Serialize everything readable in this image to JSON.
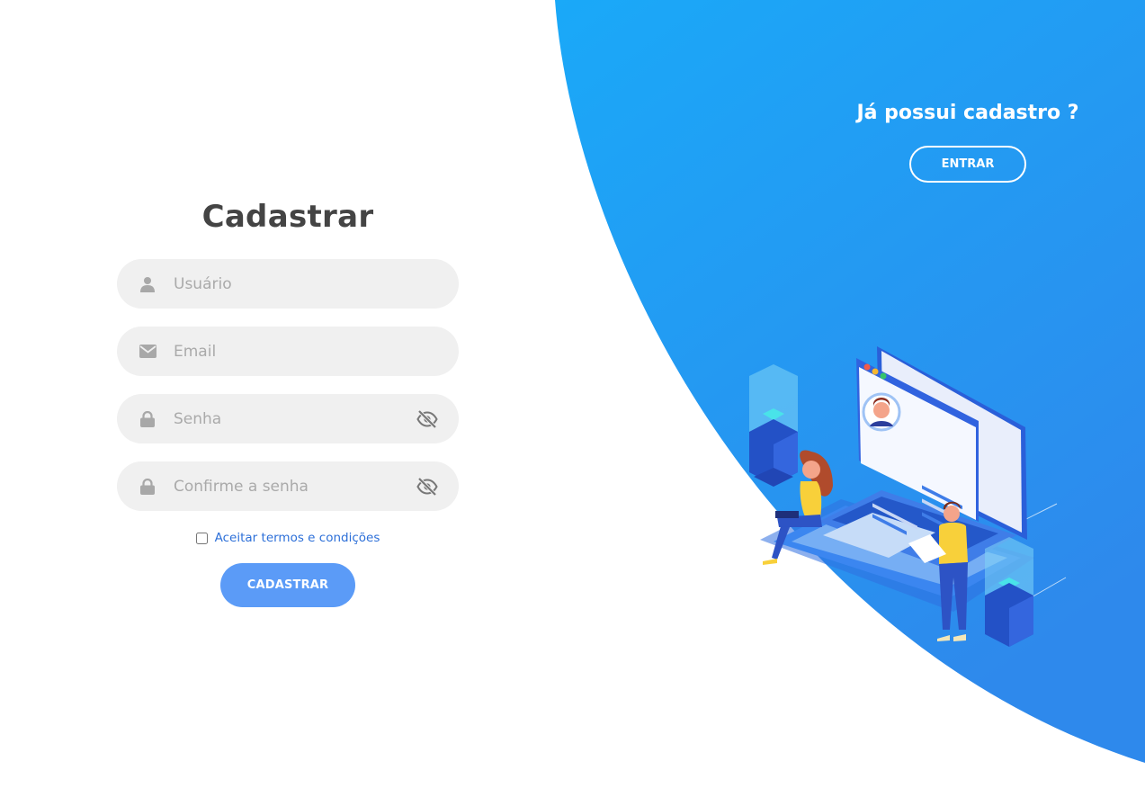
{
  "colors": {
    "accent_blue": "#5b9bf7",
    "panel_blue_top": "#1aa9f8",
    "panel_blue_bottom": "#2e89ec",
    "field_bg": "#f0f0f0",
    "title_text": "#444444",
    "link_text": "#2c6fd8"
  },
  "register": {
    "title": "Cadastrar",
    "fields": {
      "username": {
        "placeholder": "Usuário",
        "icon": "user-icon"
      },
      "email": {
        "placeholder": "Email",
        "icon": "envelope-icon"
      },
      "password": {
        "placeholder": "Senha",
        "icon": "lock-icon",
        "toggle_icon": "eye-slash-icon"
      },
      "confirm_password": {
        "placeholder": "Confirme a senha",
        "icon": "lock-icon",
        "toggle_icon": "eye-slash-icon"
      }
    },
    "terms_label": "Aceitar termos e condições",
    "submit_label": "CADASTRAR"
  },
  "login_prompt": {
    "title": "Já possui cadastro ?",
    "button_label": "ENTRAR"
  }
}
